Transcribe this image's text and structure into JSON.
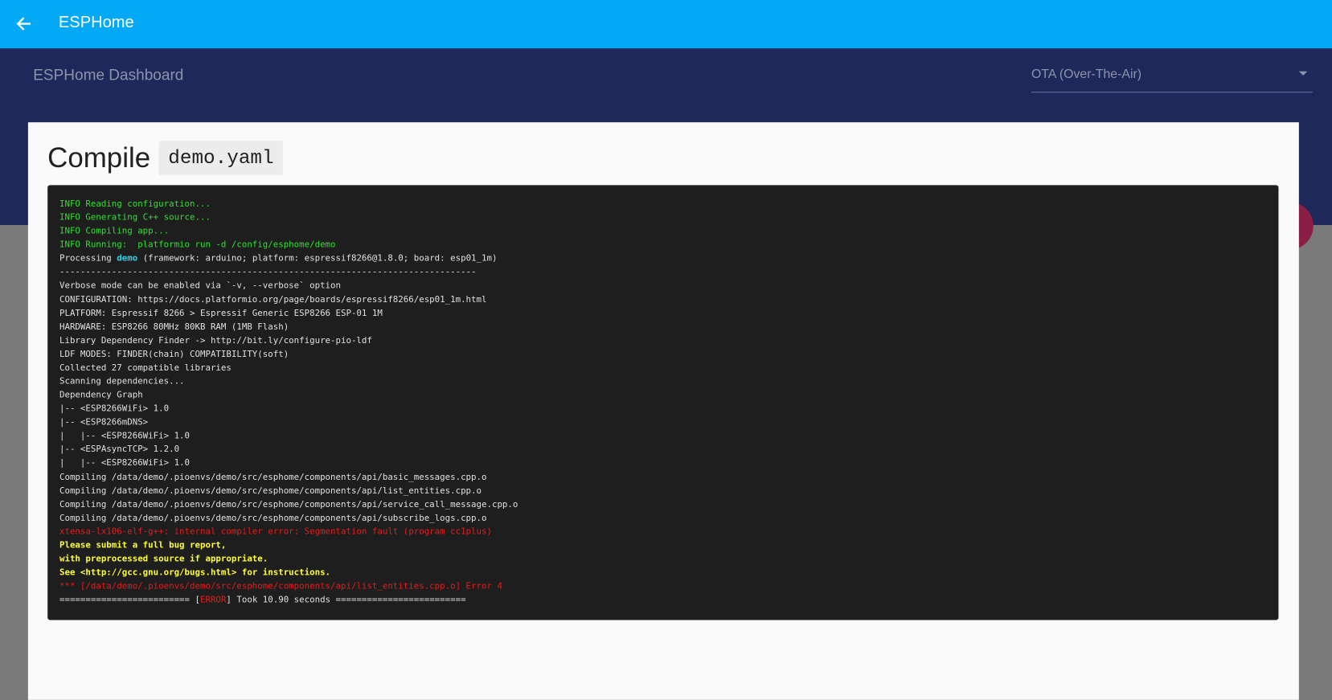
{
  "topbar": {
    "title": "ESPHome",
    "back_icon": "arrow-left-icon"
  },
  "header": {
    "dashboard_title": "ESPHome Dashboard",
    "upload_method": "OTA (Over-The-Air)"
  },
  "modal": {
    "title": "Compile",
    "filename": "demo.yaml"
  },
  "colors": {
    "topbar": "#03a9f4",
    "band": "#1f285b",
    "info": "#2ee02e",
    "error": "#e51c1c",
    "warning": "#ffff33",
    "highlight": "#22d6e8"
  },
  "log": [
    {
      "c": "g",
      "t": "INFO Reading configuration..."
    },
    {
      "c": "g",
      "t": "INFO Generating C++ source..."
    },
    {
      "c": "g",
      "t": "INFO Compiling app..."
    },
    {
      "c": "g",
      "t": "INFO Running:  platformio run -d /config/esphome/demo"
    },
    {
      "parts": [
        {
          "t": "Processing "
        },
        {
          "c": "c",
          "t": "demo"
        },
        {
          "t": " (framework: arduino; platform: espressif8266@1.8.0; board: esp01_1m)"
        }
      ]
    },
    {
      "t": "--------------------------------------------------------------------------------"
    },
    {
      "t": "Verbose mode can be enabled via `-v, --verbose` option"
    },
    {
      "t": "CONFIGURATION: https://docs.platformio.org/page/boards/espressif8266/esp01_1m.html"
    },
    {
      "t": "PLATFORM: Espressif 8266 > Espressif Generic ESP8266 ESP-01 1M"
    },
    {
      "t": "HARDWARE: ESP8266 80MHz 80KB RAM (1MB Flash)"
    },
    {
      "t": "Library Dependency Finder -> http://bit.ly/configure-pio-ldf"
    },
    {
      "t": "LDF MODES: FINDER(chain) COMPATIBILITY(soft)"
    },
    {
      "t": "Collected 27 compatible libraries"
    },
    {
      "t": "Scanning dependencies..."
    },
    {
      "t": "Dependency Graph"
    },
    {
      "t": "|-- <ESP8266WiFi> 1.0"
    },
    {
      "t": "|-- <ESP8266mDNS>"
    },
    {
      "t": "|   |-- <ESP8266WiFi> 1.0"
    },
    {
      "t": "|-- <ESPAsyncTCP> 1.2.0"
    },
    {
      "t": "|   |-- <ESP8266WiFi> 1.0"
    },
    {
      "t": "Compiling /data/demo/.pioenvs/demo/src/esphome/components/api/basic_messages.cpp.o"
    },
    {
      "t": "Compiling /data/demo/.pioenvs/demo/src/esphome/components/api/list_entities.cpp.o"
    },
    {
      "t": "Compiling /data/demo/.pioenvs/demo/src/esphome/components/api/service_call_message.cpp.o"
    },
    {
      "t": "Compiling /data/demo/.pioenvs/demo/src/esphome/components/api/subscribe_logs.cpp.o"
    },
    {
      "c": "r",
      "t": "xtensa-lx106-elf-g++: internal compiler error: Segmentation fault (program cc1plus)"
    },
    {
      "c": "y",
      "t": "Please submit a full bug report,"
    },
    {
      "c": "y",
      "t": "with preprocessed source if appropriate."
    },
    {
      "c": "y",
      "t": "See <http://gcc.gnu.org/bugs.html> for instructions."
    },
    {
      "c": "r",
      "t": "*** [/data/demo/.pioenvs/demo/src/esphome/components/api/list_entities.cpp.o] Error 4"
    },
    {
      "parts": [
        {
          "t": "========================= ["
        },
        {
          "c": "r",
          "t": "ERROR"
        },
        {
          "t": "] Took 10.90 seconds ========================="
        }
      ]
    }
  ]
}
